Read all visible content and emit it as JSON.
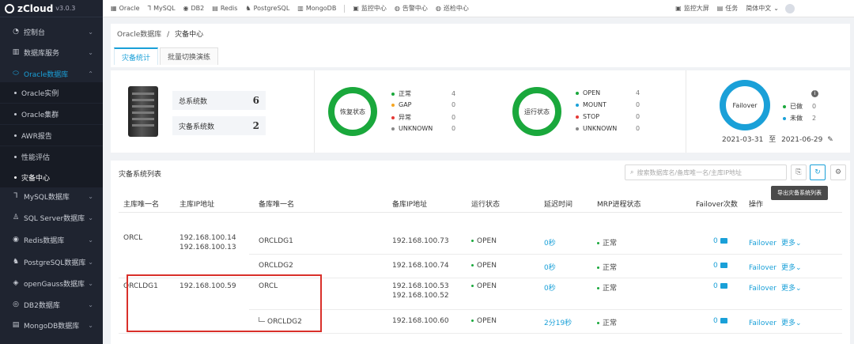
{
  "app": {
    "name": "zCloud",
    "version": "v3.0.3"
  },
  "sidebar": {
    "items": [
      {
        "label": "控制台",
        "icon": "dashboard-icon",
        "glyph": "◔"
      },
      {
        "label": "数据库服务",
        "icon": "chart-icon",
        "glyph": "▥"
      },
      {
        "label": "Oracle数据库",
        "icon": "oracle-icon",
        "glyph": "⬭"
      },
      {
        "label": "MySQL数据库",
        "icon": "mysql-icon",
        "glyph": "⅂"
      },
      {
        "label": "SQL Server数据库",
        "icon": "sqlserver-icon",
        "glyph": "♙"
      },
      {
        "label": "Redis数据库",
        "icon": "redis-icon",
        "glyph": "◉"
      },
      {
        "label": "PostgreSQL数据库",
        "icon": "postgresql-icon",
        "glyph": "♞"
      },
      {
        "label": "openGauss数据库",
        "icon": "opengauss-icon",
        "glyph": "◈"
      },
      {
        "label": "DB2数据库",
        "icon": "db2-icon",
        "glyph": "◎"
      },
      {
        "label": "MongoDB数据库",
        "icon": "mongodb-icon",
        "glyph": "▤"
      }
    ],
    "oracle_sub": [
      "Oracle实例",
      "Oracle集群",
      "AWR报告",
      "性能评估",
      "灾备中心"
    ]
  },
  "topbar": {
    "db_links": [
      {
        "label": "Oracle",
        "glyph": "▦"
      },
      {
        "label": "MySQL",
        "glyph": "⅂"
      },
      {
        "label": "DB2",
        "glyph": "◉"
      },
      {
        "label": "Redis",
        "glyph": "▤"
      },
      {
        "label": "PostgreSQL",
        "glyph": "♞"
      },
      {
        "label": "MongoDB",
        "glyph": "▥"
      }
    ],
    "centers": [
      {
        "label": "监控中心",
        "glyph": "▣"
      },
      {
        "label": "告警中心",
        "glyph": "◍"
      },
      {
        "label": "巡检中心",
        "glyph": "◍"
      }
    ],
    "right": {
      "screen": "监控大屏",
      "tasks": "任务",
      "lang": "简体中文"
    }
  },
  "breadcrumb": {
    "parent": "Oracle数据库",
    "sep": "/",
    "current": "灾备中心"
  },
  "tabs": [
    "灾备统计",
    "批量切换演练"
  ],
  "stats": {
    "total_label": "总系统数",
    "total": "6",
    "dr_label": "灾备系统数",
    "dr": "2"
  },
  "recovery": {
    "ring_label": "恢复状态",
    "legend": [
      {
        "label": "正常",
        "value": "4",
        "color": "#1aa83c"
      },
      {
        "label": "GAP",
        "value": "0",
        "color": "#f5a623"
      },
      {
        "label": "异常",
        "value": "0",
        "color": "#e53935"
      },
      {
        "label": "UNKNOWN",
        "value": "0",
        "color": "#888888"
      }
    ]
  },
  "running": {
    "ring_label": "运行状态",
    "legend": [
      {
        "label": "OPEN",
        "value": "4",
        "color": "#1aa83c"
      },
      {
        "label": "MOUNT",
        "value": "0",
        "color": "#1aa0d8"
      },
      {
        "label": "STOP",
        "value": "0",
        "color": "#e53935"
      },
      {
        "label": "UNKNOWN",
        "value": "0",
        "color": "#888888"
      }
    ]
  },
  "failover": {
    "ring_label": "Failover",
    "legend": [
      {
        "label": "已做",
        "value": "0",
        "color": "#1aa83c"
      },
      {
        "label": "未做",
        "value": "2",
        "color": "#1aa0d8"
      }
    ],
    "date_from": "2021-03-31",
    "date_sep": "至",
    "date_to": "2021-06-29"
  },
  "table": {
    "title": "灾备系统列表",
    "search_placeholder": "搜索数据库名/备库唯一名/主库IP地址",
    "tooltip": "导出灾备系统列表",
    "columns": [
      "主库唯一名",
      "主库IP地址",
      "备库唯一名",
      "备库IP地址",
      "运行状态",
      "延迟时间",
      "MRP进程状态",
      "Failover次数",
      "操作"
    ],
    "rows": [
      {
        "primary": "ORCL",
        "primary_ip": [
          "192.168.100.14",
          "192.168.100.13"
        ],
        "standby": "ORCLDG1",
        "standby_ip": [
          "192.168.100.73"
        ],
        "status": "OPEN",
        "delay": "0秒",
        "mrp": "正常",
        "failover_count": "0"
      },
      {
        "primary": "",
        "primary_ip": [],
        "standby": "ORCLDG2",
        "standby_ip": [
          "192.168.100.74"
        ],
        "status": "OPEN",
        "delay": "0秒",
        "mrp": "正常",
        "failover_count": "0"
      },
      {
        "primary": "ORCLDG1",
        "primary_ip": [
          "192.168.100.59"
        ],
        "standby": "ORCL",
        "standby_ip": [
          "192.168.100.53",
          "192.168.100.52"
        ],
        "status": "OPEN",
        "delay": "0秒",
        "mrp": "正常",
        "failover_count": "0"
      },
      {
        "primary": "",
        "primary_ip": [],
        "standby": "ORCLDG2",
        "standby_ip": [
          "192.168.100.60"
        ],
        "status": "OPEN",
        "delay": "2分19秒",
        "mrp": "正常",
        "failover_count": "0"
      }
    ],
    "action_failover": "Failover",
    "action_more": "更多"
  }
}
